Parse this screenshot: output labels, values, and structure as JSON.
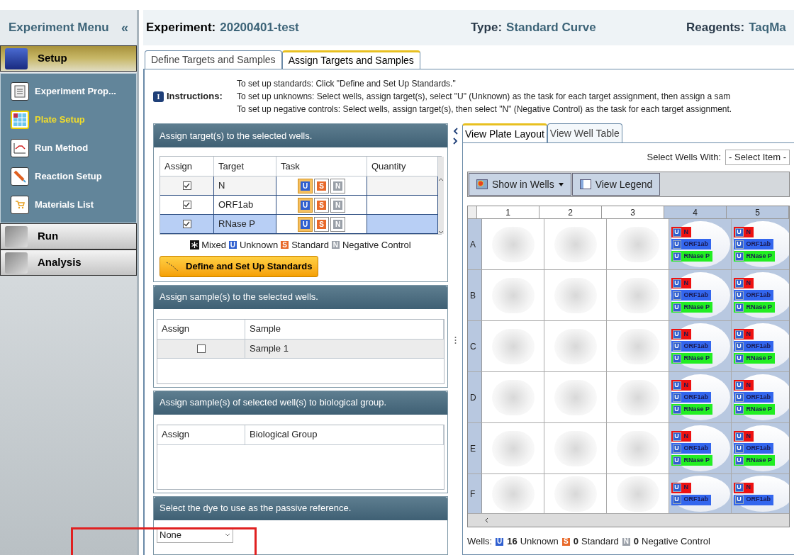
{
  "sidebar": {
    "title": "Experiment Menu",
    "collapse": "«",
    "sections": [
      {
        "label": "Setup",
        "expanded": true,
        "items": [
          {
            "label": "Experiment Prop...",
            "selected": false
          },
          {
            "label": "Plate Setup",
            "selected": true
          },
          {
            "label": "Run Method",
            "selected": false
          },
          {
            "label": "Reaction Setup",
            "selected": false
          },
          {
            "label": "Materials List",
            "selected": false
          }
        ]
      },
      {
        "label": "Run",
        "expanded": false
      },
      {
        "label": "Analysis",
        "expanded": false
      }
    ]
  },
  "header": {
    "fields": [
      {
        "label": "Experiment:",
        "value": "20200401-test"
      },
      {
        "label": "Type:",
        "value": "Standard Curve"
      },
      {
        "label": "Reagents:",
        "value": "TaqMa"
      }
    ]
  },
  "tabs": [
    {
      "label": "Define Targets and Samples",
      "selected": false
    },
    {
      "label": "Assign Targets and Samples",
      "selected": true
    }
  ],
  "instructions": {
    "icon": "I",
    "label": "Instructions:",
    "lines": [
      "To set up standards: Click \"Define and Set Up Standards.\"",
      "To set up unknowns: Select wells, assign target(s), select \"U\" (Unknown) as the task for each target assignment, then assign a sam",
      "To set up negative controls: Select wells, assign target(s), then select \"N\" (Negative Control) as the task for each target assignment."
    ]
  },
  "targets_panel": {
    "title": "Assign target(s) to the selected wells.",
    "columns": [
      "Assign",
      "Target",
      "Task",
      "Quantity"
    ],
    "rows": [
      {
        "checked": true,
        "target": "N",
        "selected": false,
        "tasks": [
          {
            "kind": "unknown",
            "label": "U",
            "selected": true
          },
          {
            "kind": "standard",
            "label": "S",
            "selected": false
          },
          {
            "kind": "negative",
            "label": "N",
            "selected": false
          }
        ]
      },
      {
        "checked": true,
        "target": "ORF1ab",
        "selected": false,
        "tasks": [
          {
            "kind": "unknown",
            "label": "U",
            "selected": true
          },
          {
            "kind": "standard",
            "label": "S",
            "selected": false
          },
          {
            "kind": "negative",
            "label": "N",
            "selected": false
          }
        ]
      },
      {
        "checked": true,
        "target": "RNase P",
        "selected": true,
        "tasks": [
          {
            "kind": "unknown",
            "label": "U",
            "selected": true
          },
          {
            "kind": "standard",
            "label": "S",
            "selected": false
          },
          {
            "kind": "negative",
            "label": "N",
            "selected": false
          }
        ]
      }
    ],
    "legend": [
      {
        "kind": "mixed",
        "label": "Mixed"
      },
      {
        "kind": "unknown",
        "badge": "U",
        "label": "Unknown"
      },
      {
        "kind": "standard",
        "badge": "S",
        "label": "Standard"
      },
      {
        "kind": "negative",
        "badge": "N",
        "label": "Negative Control"
      }
    ],
    "button": "Define and Set Up Standards"
  },
  "samples_panel": {
    "title": "Assign sample(s) to the selected wells.",
    "columns": [
      "Assign",
      "Sample"
    ],
    "rows": [
      {
        "checked": false,
        "sample": "Sample 1",
        "selected": true
      }
    ]
  },
  "group_panel": {
    "title": "Assign sample(s) of selected well(s) to biological group.",
    "columns": [
      "Assign",
      "Biological Group"
    ]
  },
  "reference_panel": {
    "title": "Select the dye to use as the passive reference.",
    "value": "None"
  },
  "plate": {
    "tabs": [
      {
        "label": "View Plate Layout",
        "selected": true
      },
      {
        "label": "View Well Table",
        "selected": false
      }
    ],
    "select_wells": {
      "label": "Select Wells With:",
      "value": "- Select Item -"
    },
    "toolbar": [
      {
        "kind": "dropdown",
        "label": "Show in Wells"
      },
      {
        "kind": "button",
        "label": "View Legend"
      }
    ],
    "columns": [
      {
        "label": "1",
        "selected": false
      },
      {
        "label": "2",
        "selected": false
      },
      {
        "label": "3",
        "selected": false
      },
      {
        "label": "4",
        "selected": true
      },
      {
        "label": "5",
        "selected": true
      }
    ],
    "rows": [
      {
        "label": "A",
        "wells": [
          {
            "kind": "empty"
          },
          {
            "kind": "empty"
          },
          {
            "kind": "empty"
          },
          {
            "kind": "assigned",
            "targets": [
              {
                "task": "U",
                "name": "N",
                "color": "#ee1111"
              },
              {
                "task": "U",
                "name": "ORF1ab",
                "color": "#3366ee"
              },
              {
                "task": "U",
                "name": "RNase P",
                "color": "#22ee22"
              }
            ]
          },
          {
            "kind": "assigned",
            "targets": [
              {
                "task": "U",
                "name": "N",
                "color": "#ee1111"
              },
              {
                "task": "U",
                "name": "ORF1ab",
                "color": "#3366ee"
              },
              {
                "task": "U",
                "name": "RNase P",
                "color": "#22ee22"
              }
            ]
          }
        ]
      },
      {
        "label": "B",
        "wells": [
          {
            "kind": "empty"
          },
          {
            "kind": "empty"
          },
          {
            "kind": "empty"
          },
          {
            "kind": "assigned",
            "targets": [
              {
                "task": "U",
                "name": "N",
                "color": "#ee1111"
              },
              {
                "task": "U",
                "name": "ORF1ab",
                "color": "#3366ee"
              },
              {
                "task": "U",
                "name": "RNase P",
                "color": "#22ee22"
              }
            ]
          },
          {
            "kind": "assigned",
            "targets": [
              {
                "task": "U",
                "name": "N",
                "color": "#ee1111"
              },
              {
                "task": "U",
                "name": "ORF1ab",
                "color": "#3366ee"
              },
              {
                "task": "U",
                "name": "RNase P",
                "color": "#22ee22"
              }
            ]
          }
        ]
      },
      {
        "label": "C",
        "wells": [
          {
            "kind": "empty"
          },
          {
            "kind": "empty"
          },
          {
            "kind": "empty"
          },
          {
            "kind": "assigned",
            "targets": [
              {
                "task": "U",
                "name": "N",
                "color": "#ee1111"
              },
              {
                "task": "U",
                "name": "ORF1ab",
                "color": "#3366ee"
              },
              {
                "task": "U",
                "name": "RNase P",
                "color": "#22ee22"
              }
            ]
          },
          {
            "kind": "assigned",
            "targets": [
              {
                "task": "U",
                "name": "N",
                "color": "#ee1111"
              },
              {
                "task": "U",
                "name": "ORF1ab",
                "color": "#3366ee"
              },
              {
                "task": "U",
                "name": "RNase P",
                "color": "#22ee22"
              }
            ]
          }
        ]
      },
      {
        "label": "D",
        "wells": [
          {
            "kind": "empty"
          },
          {
            "kind": "empty"
          },
          {
            "kind": "empty"
          },
          {
            "kind": "assigned",
            "targets": [
              {
                "task": "U",
                "name": "N",
                "color": "#ee1111"
              },
              {
                "task": "U",
                "name": "ORF1ab",
                "color": "#3366ee"
              },
              {
                "task": "U",
                "name": "RNase P",
                "color": "#22ee22"
              }
            ]
          },
          {
            "kind": "assigned",
            "targets": [
              {
                "task": "U",
                "name": "N",
                "color": "#ee1111"
              },
              {
                "task": "U",
                "name": "ORF1ab",
                "color": "#3366ee"
              },
              {
                "task": "U",
                "name": "RNase P",
                "color": "#22ee22"
              }
            ]
          }
        ]
      },
      {
        "label": "E",
        "wells": [
          {
            "kind": "empty"
          },
          {
            "kind": "empty"
          },
          {
            "kind": "empty"
          },
          {
            "kind": "assigned",
            "targets": [
              {
                "task": "U",
                "name": "N",
                "color": "#ee1111"
              },
              {
                "task": "U",
                "name": "ORF1ab",
                "color": "#3366ee"
              },
              {
                "task": "U",
                "name": "RNase P",
                "color": "#22ee22"
              }
            ]
          },
          {
            "kind": "assigned",
            "targets": [
              {
                "task": "U",
                "name": "N",
                "color": "#ee1111"
              },
              {
                "task": "U",
                "name": "ORF1ab",
                "color": "#3366ee"
              },
              {
                "task": "U",
                "name": "RNase P",
                "color": "#22ee22"
              }
            ]
          }
        ]
      },
      {
        "label": "F",
        "wells": [
          {
            "kind": "empty"
          },
          {
            "kind": "empty"
          },
          {
            "kind": "empty"
          },
          {
            "kind": "assigned",
            "targets": [
              {
                "task": "U",
                "name": "N",
                "color": "#ee1111"
              },
              {
                "task": "U",
                "name": "ORF1ab",
                "color": "#3366ee"
              }
            ]
          },
          {
            "kind": "assigned",
            "targets": [
              {
                "task": "U",
                "name": "N",
                "color": "#ee1111"
              },
              {
                "task": "U",
                "name": "ORF1ab",
                "color": "#3366ee"
              }
            ]
          }
        ]
      }
    ]
  },
  "footer": {
    "label": "Wells:",
    "counts": [
      {
        "kind": "unknown",
        "badge": "U",
        "count": "16",
        "label": "Unknown"
      },
      {
        "kind": "standard",
        "badge": "S",
        "count": "0",
        "label": "Standard"
      },
      {
        "kind": "negative",
        "badge": "N",
        "count": "0",
        "label": "Negative Control"
      }
    ]
  }
}
